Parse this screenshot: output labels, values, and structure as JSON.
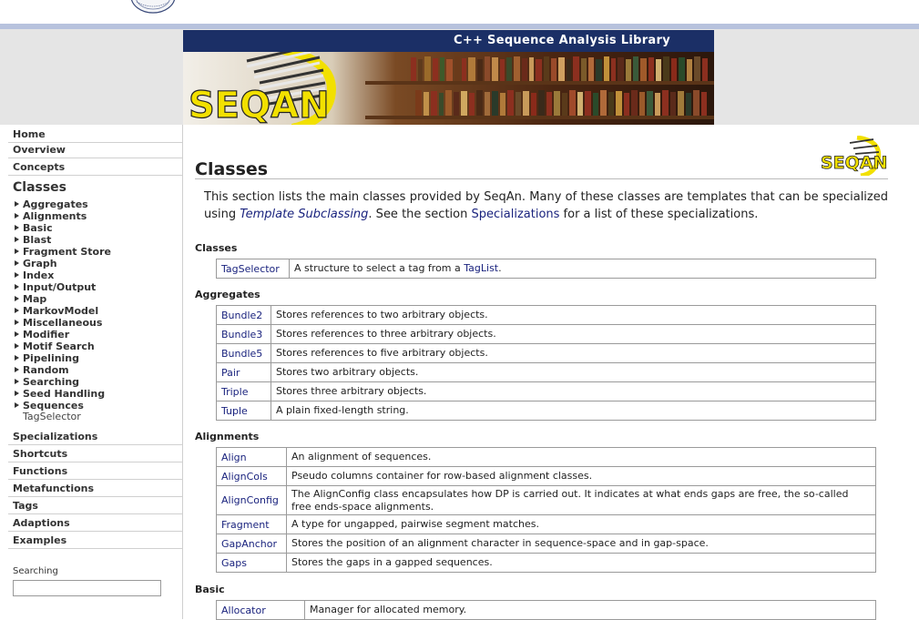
{
  "banner": {
    "title": "C++ Sequence Analysis Library"
  },
  "sidebar": {
    "top_items": [
      {
        "label": "Home"
      },
      {
        "label": "Overview"
      },
      {
        "label": "Concepts"
      }
    ],
    "current_section": "Classes",
    "sub_items": [
      "Aggregates",
      "Alignments",
      "Basic",
      "Blast",
      "Fragment Store",
      "Graph",
      "Index",
      "Input/Output",
      "Map",
      "MarkovModel",
      "Miscellaneous",
      "Modifier",
      "Motif Search",
      "Pipelining",
      "Random",
      "Searching",
      "Seed Handling",
      "Sequences"
    ],
    "current_item": "TagSelector",
    "bottom_items": [
      "Specializations",
      "Shortcuts",
      "Functions",
      "Metafunctions",
      "Tags",
      "Adaptions",
      "Examples"
    ],
    "search": {
      "label": "Searching",
      "value": ""
    }
  },
  "main": {
    "title": "Classes",
    "intro": {
      "part1": "This section lists the main classes provided by SeqAn. Many of these classes are templates that can be specialized using ",
      "link1": "Template Subclassing",
      "part2": ". See the section ",
      "link2": "Specializations",
      "part3": " for a list of these specializations."
    },
    "sections": {
      "classes": {
        "heading": "Classes",
        "rows": [
          {
            "name": "TagSelector",
            "desc": "A structure to select a tag from a ",
            "link": "TagList",
            "tail": "."
          }
        ]
      },
      "aggregates": {
        "heading": "Aggregates",
        "rows": [
          {
            "name": "Bundle2",
            "desc": "Stores references to two arbitrary objects."
          },
          {
            "name": "Bundle3",
            "desc": "Stores references to three arbitrary objects."
          },
          {
            "name": "Bundle5",
            "desc": "Stores references to five arbitrary objects."
          },
          {
            "name": "Pair",
            "desc": "Stores two arbitrary objects."
          },
          {
            "name": "Triple",
            "desc": "Stores three arbitrary objects."
          },
          {
            "name": "Tuple",
            "desc": "A plain fixed-length string."
          }
        ]
      },
      "alignments": {
        "heading": "Alignments",
        "rows": [
          {
            "name": "Align",
            "desc": "An alignment of sequences."
          },
          {
            "name": "AlignCols",
            "desc": "Pseudo columns container for row-based alignment classes."
          },
          {
            "name": "AlignConfig",
            "desc": "The AlignConfig class encapsulates how DP is carried out. It indicates at what ends gaps are free, the so-called free ends-space alignments."
          },
          {
            "name": "Fragment",
            "desc": "A type for ungapped, pairwise segment matches."
          },
          {
            "name": "GapAnchor",
            "desc": "Stores the position of an alignment character in sequence-space and in gap-space."
          },
          {
            "name": "Gaps",
            "desc": "Stores the gaps in a gapped sequences."
          }
        ]
      },
      "basic": {
        "heading": "Basic",
        "rows": [
          {
            "name": "Allocator",
            "desc": "Manager for allocated memory."
          }
        ]
      }
    }
  },
  "colors": {
    "banner_bar": "#1b2f66",
    "link": "#1a237e",
    "accent_yellow": "#f2e000"
  },
  "icons": [
    "university-seal-icon",
    "seqan-logo-icon",
    "triangle-right-icon"
  ]
}
